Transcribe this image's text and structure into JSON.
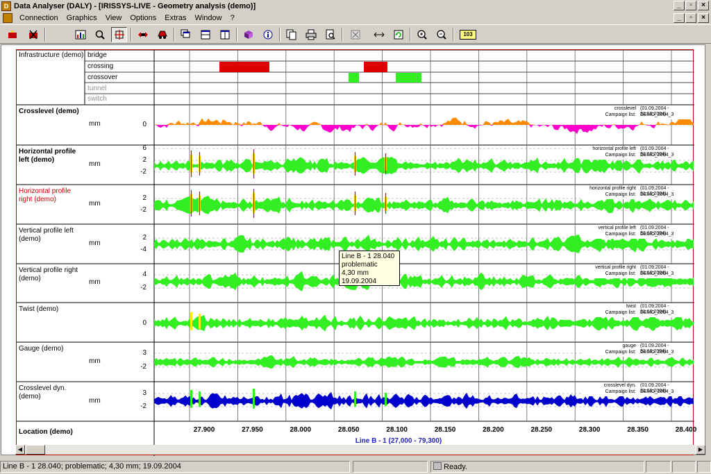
{
  "window": {
    "title": "Data Analyser (DALY) - [IRISSYS-LIVE - Geometry analysis (demo)]",
    "app_icon": "app-logo-icon",
    "controls": [
      "minimize-icon",
      "restore-icon",
      "close-icon"
    ]
  },
  "menu": {
    "items": [
      "Connection",
      "Graphics",
      "View",
      "Options",
      "Extras",
      "Window",
      "?"
    ]
  },
  "toolbar": {
    "counter_label": "103"
  },
  "infrastructure": {
    "title": "Infrastructure (demo)",
    "rows": [
      "bridge",
      "crossing",
      "crossover",
      "tunnel",
      "switch"
    ],
    "colors": {
      "crossing": "#ff0000",
      "crossover": "#66ff33"
    }
  },
  "channels": [
    {
      "title": "Crosslevel (demo)",
      "unit": "mm",
      "ticks": [
        "0"
      ],
      "legend_name": "crosslevel",
      "legend_list": "Campaign list:",
      "range": "(01.09.2004 - 31.10.2004)",
      "campaign": "DEMO_2004_3",
      "style": "bold"
    },
    {
      "title": "Horizontal profile left (demo)",
      "unit": "mm",
      "ticks": [
        "6",
        "2",
        "-2"
      ],
      "legend_name": "horizontal profile left",
      "legend_list": "Campaign list:",
      "range": "(01.09.2004 - 31.10.2004)",
      "campaign": "DEMO_2004_3",
      "style": "bold"
    },
    {
      "title": "Horizontal profile right (demo)",
      "unit": "mm",
      "ticks": [
        "2",
        "-2"
      ],
      "legend_name": "horizontal profile right",
      "legend_list": "Campaign list:",
      "range": "(01.09.2004 - 31.10.2004)",
      "campaign": "DEMO_2004_3",
      "style": "red"
    },
    {
      "title": "Vertical profile left (demo)",
      "unit": "mm",
      "ticks": [
        "2",
        "-4"
      ],
      "legend_name": "vertical profile left",
      "legend_list": "Campaign list:",
      "range": "(01.09.2004 - 31.10.2004)",
      "campaign": "DEMO_2004_3",
      "style": "normal"
    },
    {
      "title": "Vertical profile right (demo)",
      "unit": "mm",
      "ticks": [
        "4",
        "-2"
      ],
      "legend_name": "vertical profile right",
      "legend_list": "Campaign list:",
      "range": "(01.09.2004 - 31.10.2004)",
      "campaign": "DEMO_2004_3",
      "style": "normal"
    },
    {
      "title": "Twist (demo)",
      "unit": "",
      "ticks": [
        "0"
      ],
      "legend_name": "twist",
      "legend_list": "Campaign list:",
      "range": "(01.09.2004 - 31.10.2004)",
      "campaign": "DEMO_2004_3",
      "style": "normal"
    },
    {
      "title": "Gauge (demo)",
      "unit": "mm",
      "ticks": [
        "3",
        "-2"
      ],
      "legend_name": "gauge",
      "legend_list": "Campaign list:",
      "range": "(01.09.2004 - 31.10.2004)",
      "campaign": "DEMO_2004_3",
      "style": "normal"
    },
    {
      "title": "Crosslevel dyn. (demo)",
      "unit": "mm",
      "ticks": [
        "3",
        "-2"
      ],
      "legend_name": "crosslevel dyn.",
      "legend_list": "Campaign list:",
      "range": "(01.09.2004 - 31.10.2004)",
      "campaign": "DEMO_2004_3",
      "style": "normal"
    }
  ],
  "location": {
    "title": "Location (demo)",
    "ticks": [
      "27.900",
      "27.950",
      "28.000",
      "28.050",
      "28.100",
      "28.150",
      "28.200",
      "28.250",
      "28.300",
      "28.350",
      "28.400"
    ],
    "line_label": "Line B - 1 (27,000 - 79,300)"
  },
  "tooltip": {
    "lines": [
      "Line B - 1 28.040",
      "problematic",
      "4,30 mm",
      "19.09.2004"
    ]
  },
  "status": {
    "message": "Line B - 1 28.040; problematic; 4,30 mm; 19.09.2004",
    "state": "Ready."
  },
  "colors": {
    "crosslevel_pos": "#ff8c00",
    "crosslevel_neg": "#ff00cc",
    "profile": "#33ee22",
    "dyn": "#0000cc",
    "warn": "#ffee00",
    "alarm": "#dd0000",
    "frame": "#b00000"
  }
}
